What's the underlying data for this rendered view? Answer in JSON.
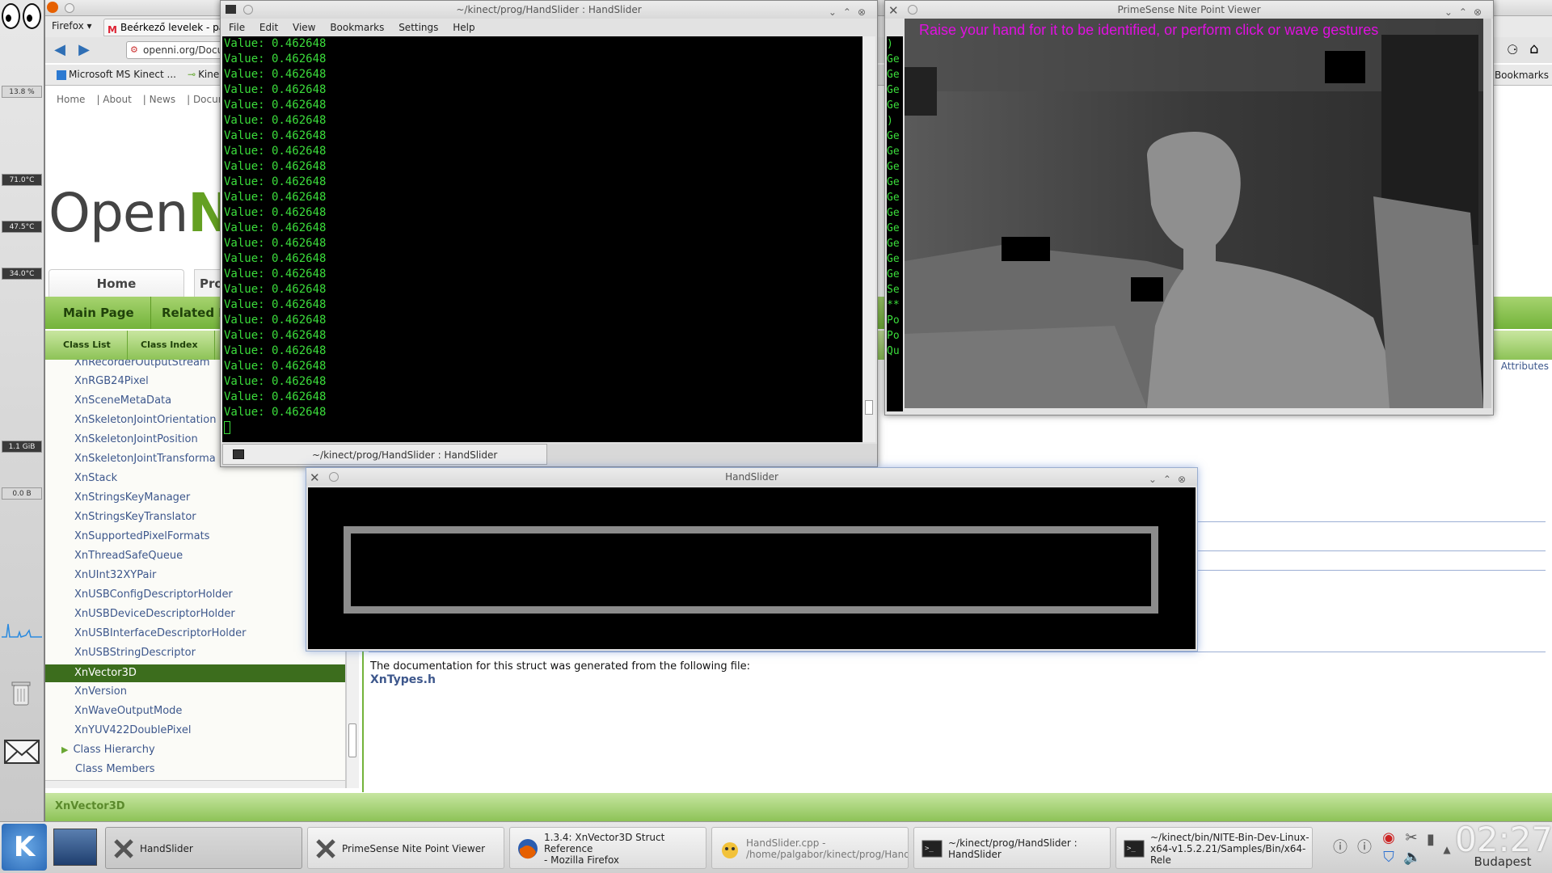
{
  "widgets": {
    "meters": [
      "13.8 %",
      "71.0°C",
      "47.5°C",
      "34.0°C",
      "1.1 GiB",
      "0.0 B"
    ]
  },
  "firefox": {
    "menu_label": "Firefox",
    "tab_label": "Beérkező levelek - pal",
    "url": "openni.org/Docume",
    "bookmarks": [
      "Microsoft MS Kinect ...",
      "Kine"
    ],
    "bookmarks_right": "Bookmarks",
    "doc_links": [
      "Home",
      "About",
      "News",
      "Docur"
    ],
    "logo_text": "Open",
    "logo_accent": "NI",
    "home_tab": "Home",
    "pro_tab": "Pro",
    "main_tabs": [
      "Main Page",
      "Related P"
    ],
    "sub_tabs": [
      "Class List",
      "Class Index"
    ],
    "tree_items": [
      "XnRecorderOutputStream",
      "XnRGB24Pixel",
      "XnSceneMetaData",
      "XnSkeletonJointOrientation",
      "XnSkeletonJointPosition",
      "XnSkeletonJointTransforma",
      "XnStack",
      "XnStringsKeyManager",
      "XnStringsKeyTranslator",
      "XnSupportedPixelFormats",
      "XnThreadSafeQueue",
      "XnUInt32XYPair",
      "XnUSBConfigDescriptorHolder",
      "XnUSBDeviceDescriptorHolder",
      "XnUSBInterfaceDescriptorHolder",
      "XnUSBStringDescriptor",
      "XnVector3D",
      "XnVersion",
      "XnWaveOutputMode",
      "XnYUV422DoublePixel"
    ],
    "selected_item": "XnVector3D",
    "tree_roots": [
      "Class Hierarchy",
      "Class Members"
    ],
    "attributes_link": "Attributes",
    "doc_text": "The documentation for this struct was generated from the following file:",
    "doc_file_link": "XnTypes.h",
    "status_crumb": "XnVector3D"
  },
  "terminal": {
    "title": "~/kinect/prog/HandSlider : HandSlider",
    "menu": [
      "File",
      "Edit",
      "View",
      "Bookmarks",
      "Settings",
      "Help"
    ],
    "line_text": "Value: 0.462648",
    "line_count": 25,
    "tab_label": "~/kinect/prog/HandSlider : HandSlider"
  },
  "viewer": {
    "title": "PrimeSense Nite Point Viewer",
    "message": "Raise your hand for it to be identified, or perform click or wave gestures",
    "side_text": [
      ")",
      "Ge",
      "Ge",
      "Ge",
      "Ge",
      ")",
      "Ge",
      "Ge",
      "Ge",
      "Ge",
      "Ge",
      "Ge",
      "Ge",
      "Ge",
      "Ge",
      "Ge",
      "Se",
      "**",
      "Po",
      "Po",
      "Qu"
    ]
  },
  "handslider": {
    "title": "HandSlider"
  },
  "taskbar": {
    "tasks": [
      {
        "label": "HandSlider",
        "icon": "x-app-icon",
        "active": true,
        "dim": false
      },
      {
        "label": "PrimeSense Nite Point Viewer",
        "icon": "x-app-icon",
        "active": false,
        "dim": false
      },
      {
        "label": "1.3.4: XnVector3D Struct Reference\n- Mozilla Firefox",
        "icon": "firefox-icon",
        "active": false,
        "dim": false
      },
      {
        "label": "HandSlider.cpp -\n/home/palgabor/kinect/prog/Hand",
        "icon": "editor-icon",
        "active": false,
        "dim": true
      },
      {
        "label": "~/kinect/prog/HandSlider :\nHandSlider",
        "icon": "terminal-icon",
        "active": false,
        "dim": false
      },
      {
        "label": "~/kinect/bin/NITE-Bin-Dev-Linux-\nx64-v1.5.2.21/Samples/Bin/x64-Rele",
        "icon": "terminal-icon",
        "active": false,
        "dim": false
      }
    ],
    "clock": "02:27",
    "city": "Budapest"
  },
  "colors": {
    "accent_green": "#73b33a",
    "terminal_text": "#3bdc3b",
    "viewer_message": "#e010e0",
    "link": "#3d578c"
  }
}
